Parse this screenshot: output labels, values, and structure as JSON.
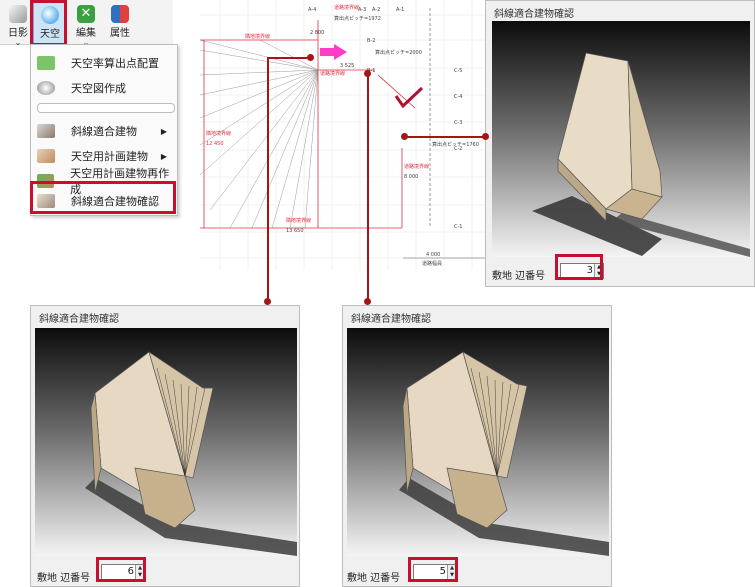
{
  "ribbon": {
    "buttons": [
      {
        "label": "日影"
      },
      {
        "label": "天空"
      },
      {
        "label": "編集"
      },
      {
        "label": "属性"
      }
    ]
  },
  "menu": {
    "items": [
      {
        "label": "天空率算出点配置"
      },
      {
        "label": "天空図作成"
      },
      {
        "label": "斜線適合建物"
      },
      {
        "label": "天空用計画建物"
      },
      {
        "label": "天空用計画建物再作成"
      },
      {
        "label": "斜線適合建物確認"
      }
    ]
  },
  "drawing": {
    "labels": {
      "a4": "A-4",
      "a3": "A-3",
      "a2": "A-2",
      "a1": "A-1",
      "road_top": "道路境界線",
      "pitch_top": "算出点ピッチ=1972",
      "dim_2800": "2 800",
      "b2": "B-2",
      "b1": "B-1",
      "pitch_b": "算出点ピッチ=2000",
      "adj_left": "隣地境界線",
      "road_mid": "道路境界線",
      "dim_3525": "3 525",
      "dim_12450": "12 450",
      "adj_side": "隣地境界線",
      "road_v": "道路境界線",
      "dim_8000": "8 000",
      "pitch_c": "算出点ピッチ=1760",
      "c5": "C-5",
      "c4": "C-4",
      "c3": "C-3",
      "c2": "C-2",
      "c1": "C-1",
      "adj_bottom": "隣地境界線",
      "dim_13650": "13 650",
      "dim_4000": "4 000",
      "road_width": "道路幅員"
    }
  },
  "panels": [
    {
      "title": "斜線適合建物確認",
      "footer_label": "敷地 辺番号",
      "value": "3"
    },
    {
      "title": "斜線適合建物確認",
      "footer_label": "敷地 辺番号",
      "value": "6"
    },
    {
      "title": "斜線適合建物確認",
      "footer_label": "敷地 辺番号",
      "value": "5"
    }
  ],
  "colors": {
    "highlight": "#c8102e",
    "connector": "#a31616",
    "drawing_red": "#e03040",
    "arrow_magenta": "#ff3cc8"
  },
  "icons": {
    "sun_shadow": "sun-shadow-icon",
    "sky": "sky-icon",
    "edit": "edit-icon",
    "attribute": "attribute-icon"
  }
}
